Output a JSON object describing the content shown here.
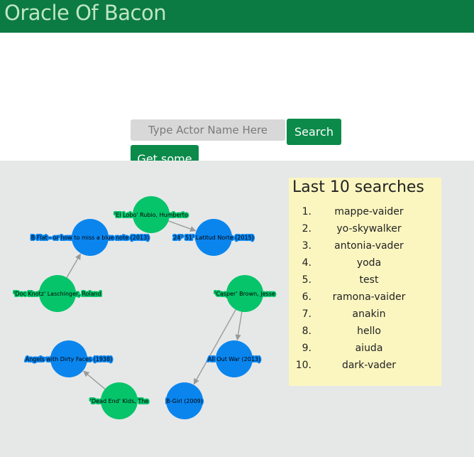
{
  "header": {
    "title": "Oracle Of Bacon"
  },
  "search": {
    "placeholder": "Type Actor Name Here",
    "value": "",
    "search_label": "Search",
    "getsome_label": "Get some"
  },
  "colors": {
    "header_bg": "#0c7a43",
    "header_text": "#bfe6c4",
    "button": "#0b8a4a",
    "actor_node": "#06c46a",
    "movie_node": "#0a85ee",
    "panel_bg": "#fbf6c0",
    "graph_bg": "#e6e8e8"
  },
  "graph": {
    "nodes": [
      {
        "id": "n1",
        "label": "'El Lobo'  Rubio, Humberto",
        "kind": "actor"
      },
      {
        "id": "n2",
        "label": "B Flat - or how to miss a blue note (2013)",
        "kind": "movie"
      },
      {
        "id": "n3",
        "label": "24° 51' Latitud Norte (2015)",
        "kind": "movie"
      },
      {
        "id": "n4",
        "label": "'Doc Knotz' Laschinger, Roland",
        "kind": "actor"
      },
      {
        "id": "n5",
        "label": "'Casper' Brown, Jesse",
        "kind": "actor"
      },
      {
        "id": "n6",
        "label": "Angels with Dirty Faces (1938)",
        "kind": "movie"
      },
      {
        "id": "n7",
        "label": "All Out War (2013)",
        "kind": "movie"
      },
      {
        "id": "n8",
        "label": "'Dead End' Kids, The",
        "kind": "actor"
      },
      {
        "id": "n9",
        "label": "B-Girl (2009)",
        "kind": "movie"
      }
    ],
    "links": [
      {
        "source": "n1",
        "target": "n3"
      },
      {
        "source": "n4",
        "target": "n2"
      },
      {
        "source": "n5",
        "target": "n7"
      },
      {
        "source": "n5",
        "target": "n9"
      },
      {
        "source": "n8",
        "target": "n6"
      }
    ]
  },
  "last_searches": {
    "title": "Last 10 searches",
    "items": [
      {
        "num": "1.",
        "term": "mappe-vaider"
      },
      {
        "num": "2.",
        "term": "yo-skywalker"
      },
      {
        "num": "3.",
        "term": "antonia-vader"
      },
      {
        "num": "4.",
        "term": "yoda"
      },
      {
        "num": "5.",
        "term": "test"
      },
      {
        "num": "6.",
        "term": "ramona-vaider"
      },
      {
        "num": "7.",
        "term": "anakin"
      },
      {
        "num": "8.",
        "term": "hello"
      },
      {
        "num": "9.",
        "term": "aiuda"
      },
      {
        "num": "10.",
        "term": "dark-vader"
      }
    ]
  }
}
